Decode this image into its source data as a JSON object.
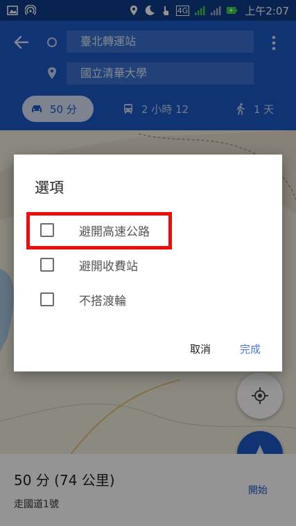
{
  "status_bar": {
    "time": "上午2:07",
    "network": "4G"
  },
  "directions": {
    "origin": "臺北轉運站",
    "destination": "國立清華大學",
    "modes": [
      {
        "id": "drive",
        "label": "50 分",
        "icon": "car-icon",
        "selected": true
      },
      {
        "id": "transit",
        "label": "2 小時 12",
        "icon": "bus-icon",
        "selected": false
      },
      {
        "id": "walk",
        "label": "1 天",
        "icon": "walk-icon",
        "selected": false
      }
    ]
  },
  "dialog": {
    "title": "選項",
    "options": [
      {
        "label": "避開高速公路",
        "checked": false
      },
      {
        "label": "避開收費站",
        "checked": false
      },
      {
        "label": "不搭渡輪",
        "checked": false
      }
    ],
    "cancel_label": "取消",
    "done_label": "完成"
  },
  "route": {
    "summary": "50 分 (74 公里)",
    "via": "走國道1號"
  },
  "start_button": {
    "label": "開始"
  },
  "colors": {
    "primary": "#1a59c7",
    "status_bar": "#0f3d8a",
    "highlight": "#f00b0b",
    "done_button": "#4a7bd0"
  }
}
